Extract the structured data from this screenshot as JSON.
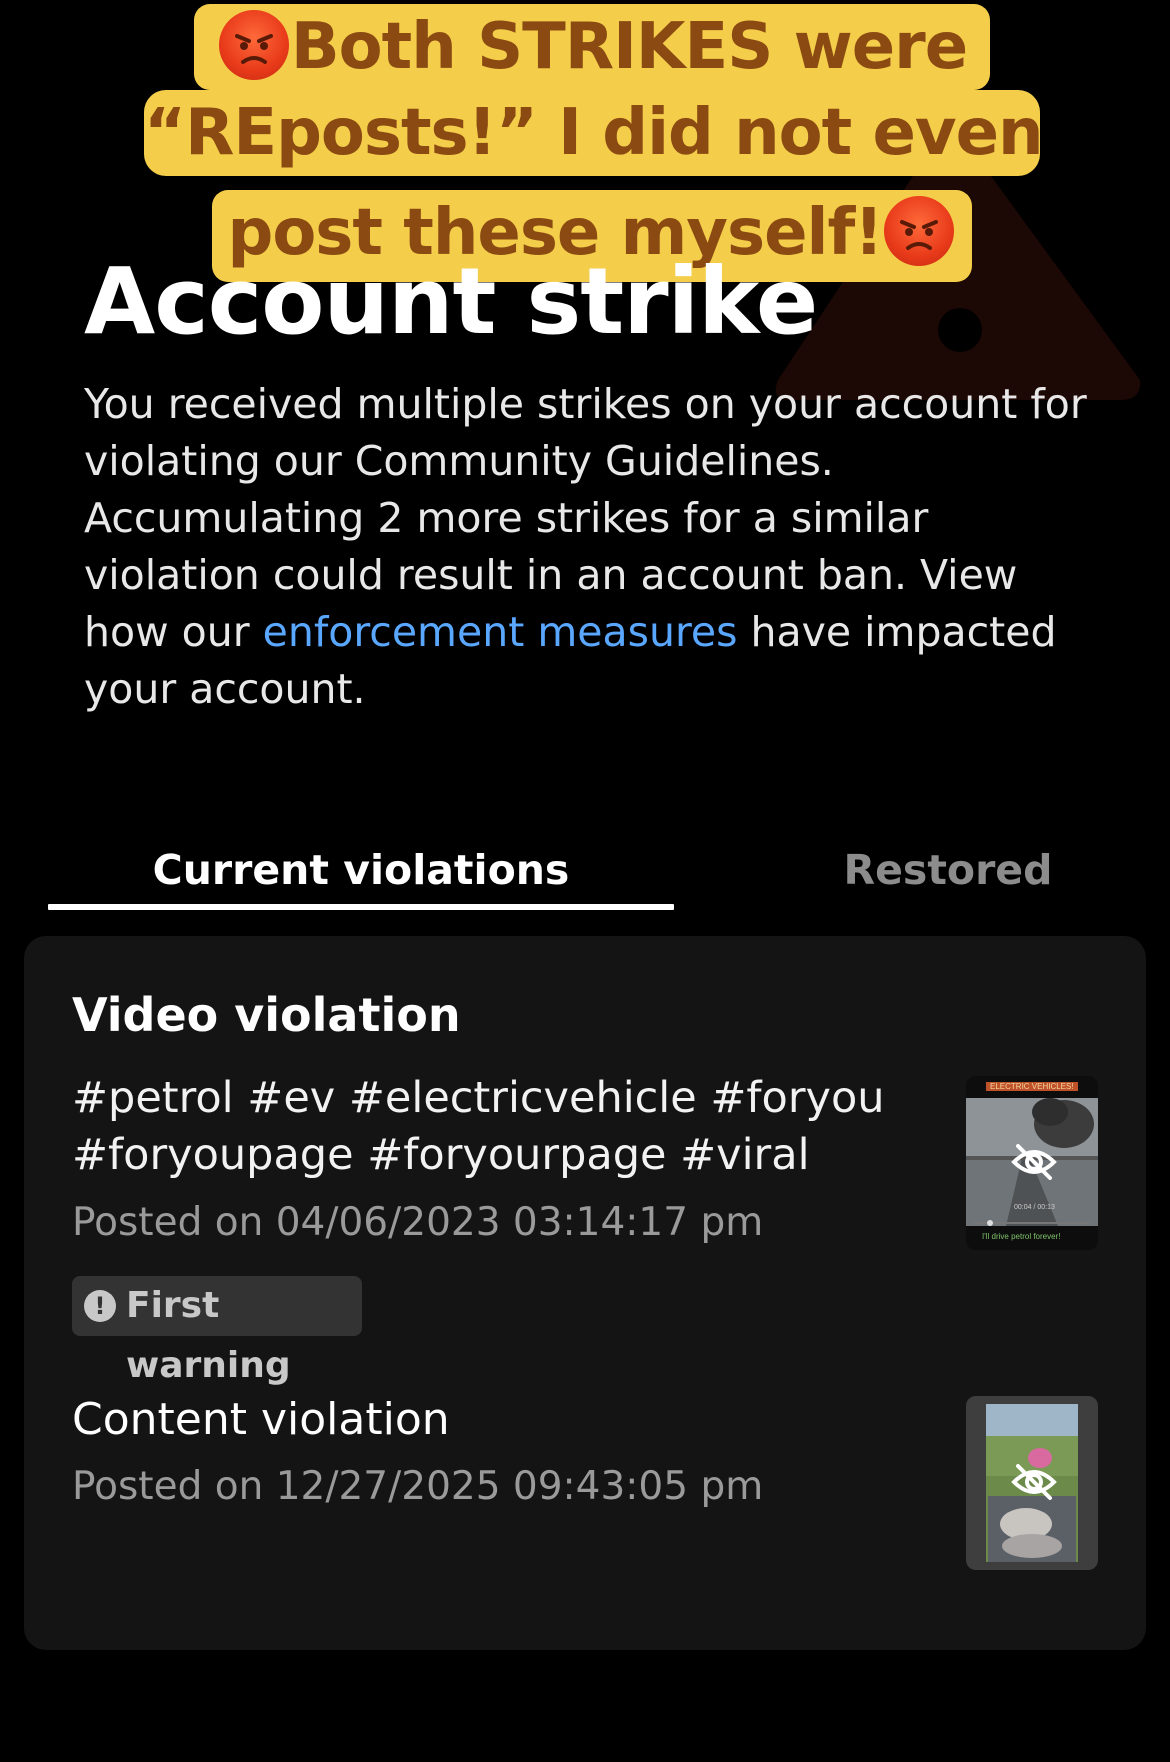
{
  "caption": {
    "line1": "Both STRIKES were",
    "line2": "“REposts!” I did not even",
    "line3": "post these myself!",
    "emoji": "angry-face"
  },
  "header": {
    "title": "Account strike",
    "description_before_link": "You received multiple strikes on your account for violating our Community Guidelines. Accumulating 2 more strikes for a similar violation could result in an account ban. View how our ",
    "link_text": "enforcement measures",
    "description_after_link": " have impacted your account."
  },
  "tabs": {
    "current": "Current violations",
    "restored": "Restored",
    "active": "current"
  },
  "violations": {
    "section_title": "Video violation",
    "items": [
      {
        "text": "#petrol #ev #electricvehicle #foryou #foryoupage #foryourpage #viral",
        "posted": "Posted on 04/06/2023 03:14:17 pm",
        "badge": "First warning",
        "thumb_caption_top": "ELECTRIC VEHICLES!",
        "thumb_caption_bottom": "I'll drive petrol forever!",
        "thumb_time": "00:04 / 00:13"
      },
      {
        "title": "Content violation",
        "posted": "Posted on 12/27/2025 09:43:05 pm"
      }
    ]
  },
  "colors": {
    "background": "#000000",
    "card": "#141414",
    "link": "#5aa7ff",
    "caption_bg": "#f4cd4a",
    "caption_text": "#8a4a12"
  }
}
